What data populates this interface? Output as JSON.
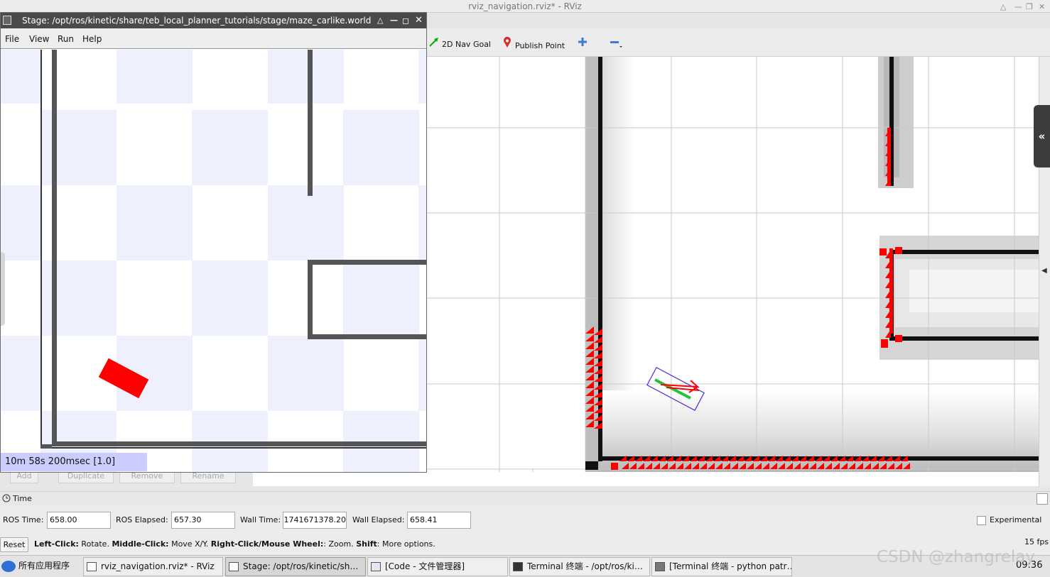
{
  "rviz": {
    "title": "rviz_navigation.rviz* - RViz",
    "toolbar": [
      {
        "label": "2D Nav Goal",
        "icon": "green-arrow-icon"
      },
      {
        "label": "Publish Point",
        "icon": "map-pin-icon"
      }
    ],
    "left_buttons": [
      "Add",
      "Duplicate",
      "Remove",
      "Rename"
    ]
  },
  "stage": {
    "title": "Stage: /opt/ros/kinetic/share/teb_local_planner_tutorials/stage/maze_carlike.world",
    "menu": [
      "File",
      "View",
      "Run",
      "Help"
    ],
    "sim_time": "10m 58s 200msec [1.0]"
  },
  "time_panel": {
    "title": "Time",
    "ros_time_label": "ROS Time:",
    "ros_time": "658.00",
    "ros_elapsed_label": "ROS Elapsed:",
    "ros_elapsed": "657.30",
    "wall_time_label": "Wall Time:",
    "wall_time": "1741671378.20",
    "wall_elapsed_label": "Wall Elapsed:",
    "wall_elapsed": "658.41",
    "experimental_label": "Experimental"
  },
  "status": {
    "reset_label": "Reset",
    "hint_1": "Left-Click:",
    "hint_1_text": " Rotate. ",
    "hint_2": "Middle-Click:",
    "hint_2_text": " Move X/Y. ",
    "hint_3": "Right-Click/Mouse Wheel:",
    "hint_3_text": ": Zoom. ",
    "hint_4": "Shift",
    "hint_4_text": ": More options.",
    "fps": "15 fps"
  },
  "taskbar": {
    "start_label": "所有应用程序",
    "tasks": [
      "rviz_navigation.rviz* - RViz",
      "Stage: /opt/ros/kinetic/sh…",
      "[Code - 文件管理器]",
      "Terminal 终端 - /opt/ros/ki…",
      "[Terminal 终端 - python patr…"
    ],
    "clock": "09:36"
  },
  "watermark": "CSDN @zhangrelay",
  "colors": {
    "obstacle_red": "#ff0000",
    "wall_black": "#111111",
    "costmap_gray": "#c8c8c8",
    "footprint_blue": "#4b2bd8",
    "plan_green": "#00c000",
    "stage_checker": "#eef0fd",
    "stage_wall": "#555555",
    "sim_time_bg": "#ccccff"
  }
}
